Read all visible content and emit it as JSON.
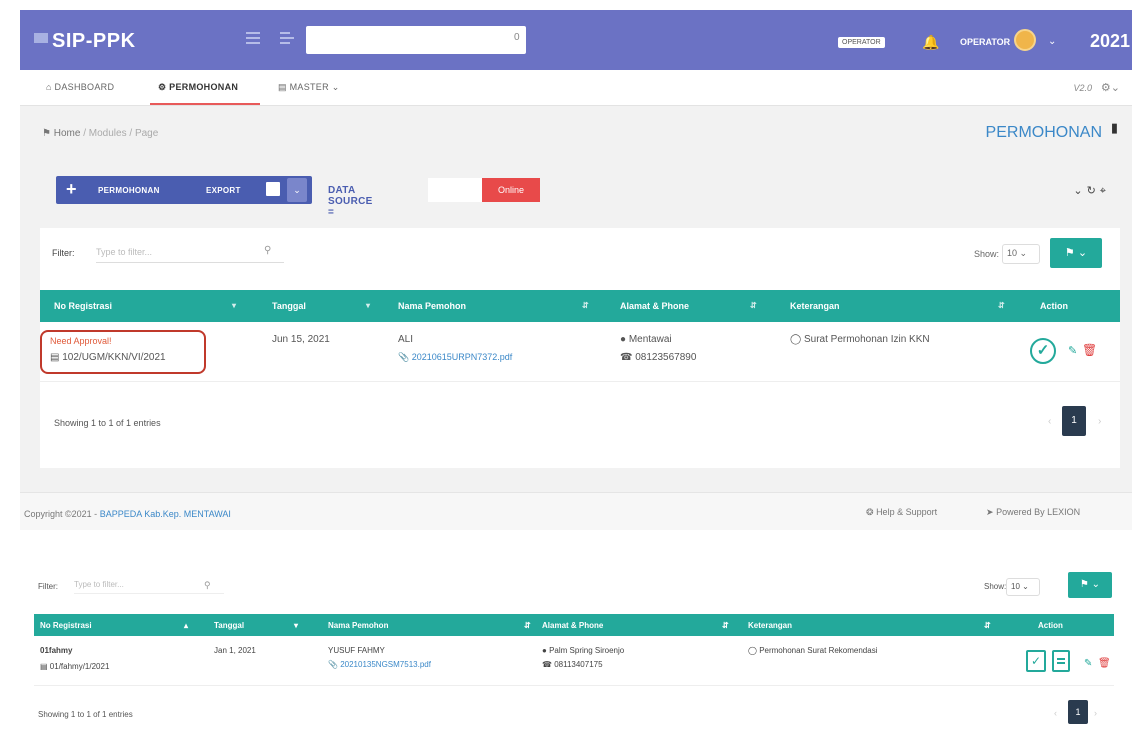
{
  "app": {
    "title": "SIP-PPK",
    "search_count": "0",
    "operator_badge": "OPERATOR",
    "user_name": "OPERATOR",
    "year": "2021",
    "version": "V2.0"
  },
  "nav": {
    "items": [
      {
        "label": "DASHBOARD",
        "icon": "home-icon"
      },
      {
        "label": "PERMOHONAN",
        "icon": "document-icon"
      },
      {
        "label": "MASTER",
        "icon": "database-icon"
      }
    ]
  },
  "breadcrumb": {
    "home": "Home",
    "modules": "Modules",
    "page": "Page",
    "sep": "/"
  },
  "page_title": "PERMOHONAN",
  "toolbar": {
    "add_label": "PERMOHONAN",
    "export_label": "EXPORT",
    "data_source_label": "DATA SOURCE =",
    "data_source_value": "",
    "online_label": "Online"
  },
  "filter": {
    "label": "Filter:",
    "placeholder": "Type to filter..."
  },
  "show": {
    "label": "Show:",
    "value": "10"
  },
  "table": {
    "headers": [
      "No Registrasi",
      "Tanggal",
      "Nama Pemohon",
      "Alamat & Phone",
      "Keterangan",
      "Action"
    ],
    "row": {
      "status": "Need Approval!",
      "reg_no": "102/UGM/KKN/VI/2021",
      "date": "Jun 15, 2021",
      "name": "ALI",
      "file": "20210615URPN7372.pdf",
      "address": "Mentawai",
      "phone": "08123567890",
      "note": "Surat Permohonan Izin KKN"
    }
  },
  "showing": "Showing 1 to 1 of 1 entries",
  "page": "1",
  "footer": {
    "copyright": "Copyright ©2021 -",
    "org": "BAPPEDA Kab.Kep. MENTAWAI",
    "help": "Help & Support",
    "powered": "Powered By LEXION"
  },
  "second": {
    "filter_label": "Filter:",
    "filter_placeholder": "Type to filter...",
    "show_label": "Show:",
    "show_value": "10",
    "headers": [
      "No Registrasi",
      "Tanggal",
      "Nama Pemohon",
      "Alamat & Phone",
      "Keterangan",
      "Action"
    ],
    "row": {
      "user": "01fahmy",
      "reg_no": "01/fahmy/1/2021",
      "date": "Jan 1, 2021",
      "name": "YUSUF FAHMY",
      "file": "20210135NGSM7513.pdf",
      "address": "Palm Spring Siroenjo",
      "phone": "08113407175",
      "note": "Permohonan Surat Rekomendasi"
    },
    "showing": "Showing 1 to 1 of 1 entries",
    "page": "1"
  },
  "colors": {
    "primary": "#6b72c4",
    "teal": "#23a99b",
    "danger": "#e84a4a",
    "link": "#3b88c8"
  }
}
